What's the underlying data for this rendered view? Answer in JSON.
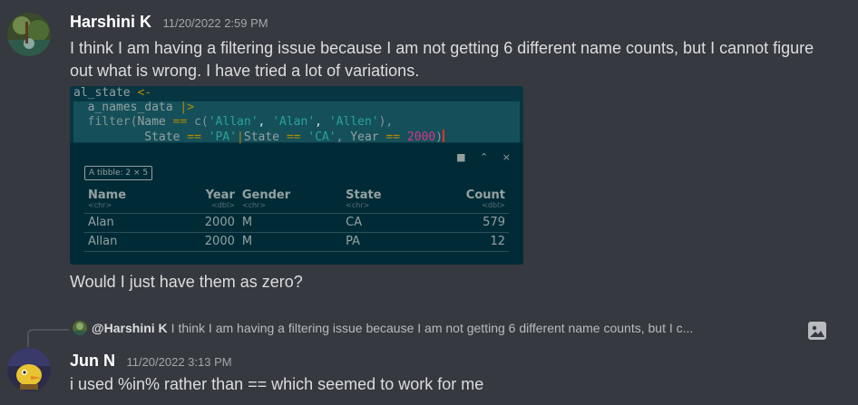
{
  "message1": {
    "username": "Harshini K",
    "timestamp": "11/20/2022 2:59 PM",
    "text": "I think I am having a filtering issue because I am not getting 6 different name counts, but I cannot figure out what is wrong. I have tried a lot of variations.",
    "followup": "Would I just have them as zero?",
    "code": {
      "line1_var": "al_state",
      "line1_op": "<-",
      "line2": "a_names_data",
      "line2_pipe": "|>",
      "line3_fn": "filter(",
      "line3_a": "Name",
      "line3_eq": "==",
      "line3_c": "c(",
      "line3_s1": "'Allan'",
      "line3_s2": "'Alan'",
      "line3_s3": "'Allen'",
      "line3_end": "),",
      "line4_a": "State",
      "line4_eq1": "==",
      "line4_s1": "'PA'",
      "line4_or": "|",
      "line4_b": "State",
      "line4_eq2": "==",
      "line4_s2": "'CA'",
      "line4_comma": ",",
      "line4_c": "Year",
      "line4_eq3": "==",
      "line4_num": "2000",
      "line4_end": ")"
    },
    "tibble": {
      "tag": "A tibble: 2 × 5",
      "columns": [
        "Name",
        "Year",
        "Gender",
        "State",
        "Count"
      ],
      "types": [
        "<chr>",
        "<dbl>",
        "<chr>",
        "<chr>",
        "<dbl>"
      ],
      "rows": [
        [
          "Alan",
          "2000",
          "M",
          "CA",
          "579"
        ],
        [
          "Allan",
          "2000",
          "M",
          "PA",
          "12"
        ]
      ]
    }
  },
  "reply_preview": {
    "mention": "@Harshini K",
    "text": "I think I am having a filtering issue because I am not getting 6 different name counts, but I c..."
  },
  "message2": {
    "username": "Jun N",
    "timestamp": "11/20/2022 3:13 PM",
    "text": "i used %in% rather than == which seemed to work for me"
  }
}
